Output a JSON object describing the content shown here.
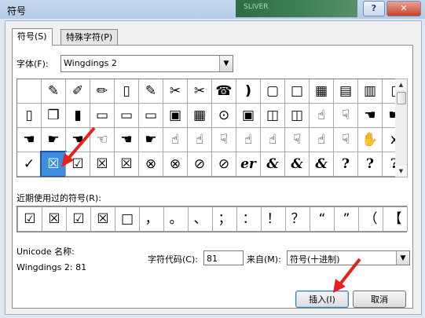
{
  "window": {
    "title": "符号"
  },
  "tabs": [
    {
      "label": "符号(S)"
    },
    {
      "label": "特殊字符(P)"
    }
  ],
  "font": {
    "label": "字体(F):",
    "value": "Wingdings 2"
  },
  "grid_rows": [
    [
      "",
      "✎",
      "✐",
      "✏",
      "▯",
      "✎",
      "✂",
      "✂",
      "☎",
      "❫",
      "▢",
      "□",
      "▦",
      "▤",
      "▥",
      "▯"
    ],
    [
      "▯",
      "❐",
      "▮",
      "▭",
      "▭",
      "▭",
      "▣",
      "▦",
      "⊙",
      "▣",
      "◫",
      "◫",
      "☝",
      "☟",
      "☚",
      "☛"
    ],
    [
      "☚",
      "☛",
      "☚",
      "☜",
      "☚",
      "☛",
      "☝",
      "☝",
      "☟",
      "☝",
      "☝",
      "☟",
      "☝",
      "☟",
      "✋",
      "x"
    ],
    [
      "✓",
      "☒",
      "☑",
      "☒",
      "☒",
      "⊗",
      "⊗",
      "⊘",
      "⊘",
      "er",
      "&",
      "&",
      "&",
      "?",
      "?",
      "?"
    ]
  ],
  "selected_cell": {
    "row": 3,
    "col": 1
  },
  "recent": {
    "label": "近期使用过的符号(R):",
    "symbols": [
      "☑",
      "☒",
      "☑",
      "☒",
      "□",
      "，",
      "。",
      "、",
      "；",
      "：",
      "！",
      "？",
      "“",
      "”",
      "（",
      "【"
    ]
  },
  "unicode": {
    "label": "Unicode 名称:",
    "value": "Wingdings 2: 81"
  },
  "char_code": {
    "label": "字符代码(C):",
    "value": "81"
  },
  "from": {
    "label": "来自(M):",
    "value": "符号(十进制)"
  },
  "buttons": {
    "insert": "插入(I)",
    "cancel": "取消"
  },
  "background_text": "SLIVER",
  "colors": {
    "selected": "#3d8ee0",
    "arrow": "#e8201a",
    "close": "#c7432a"
  }
}
